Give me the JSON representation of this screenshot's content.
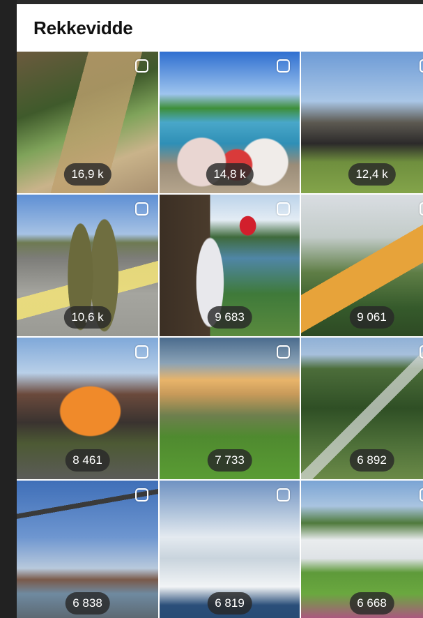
{
  "header": {
    "title": "Rekkevidde"
  },
  "tiles": [
    {
      "count": "16,9 k",
      "scene": "forest-boardwalk"
    },
    {
      "count": "14,8 k",
      "scene": "kids-at-waterpark"
    },
    {
      "count": "12,4 k",
      "scene": "crowd-on-lawn"
    },
    {
      "count": "10,6 k",
      "scene": "pilots-on-runway"
    },
    {
      "count": "9 683",
      "scene": "woman-with-flag-fjord"
    },
    {
      "count": "9 061",
      "scene": "child-in-hammock"
    },
    {
      "count": "8 461",
      "scene": "street-parade"
    },
    {
      "count": "7 733",
      "scene": "orchard-sunset"
    },
    {
      "count": "6 892",
      "scene": "mountain-valley-ski-jump"
    },
    {
      "count": "6 838",
      "scene": "harbor-crane"
    },
    {
      "count": "6 819",
      "scene": "snowy-mountains"
    },
    {
      "count": "6 668",
      "scene": "white-house-garden"
    }
  ],
  "colors": {
    "panel_bg": "#ffffff",
    "chrome_bg": "#1f1f1f",
    "badge_bg": "#282828"
  }
}
